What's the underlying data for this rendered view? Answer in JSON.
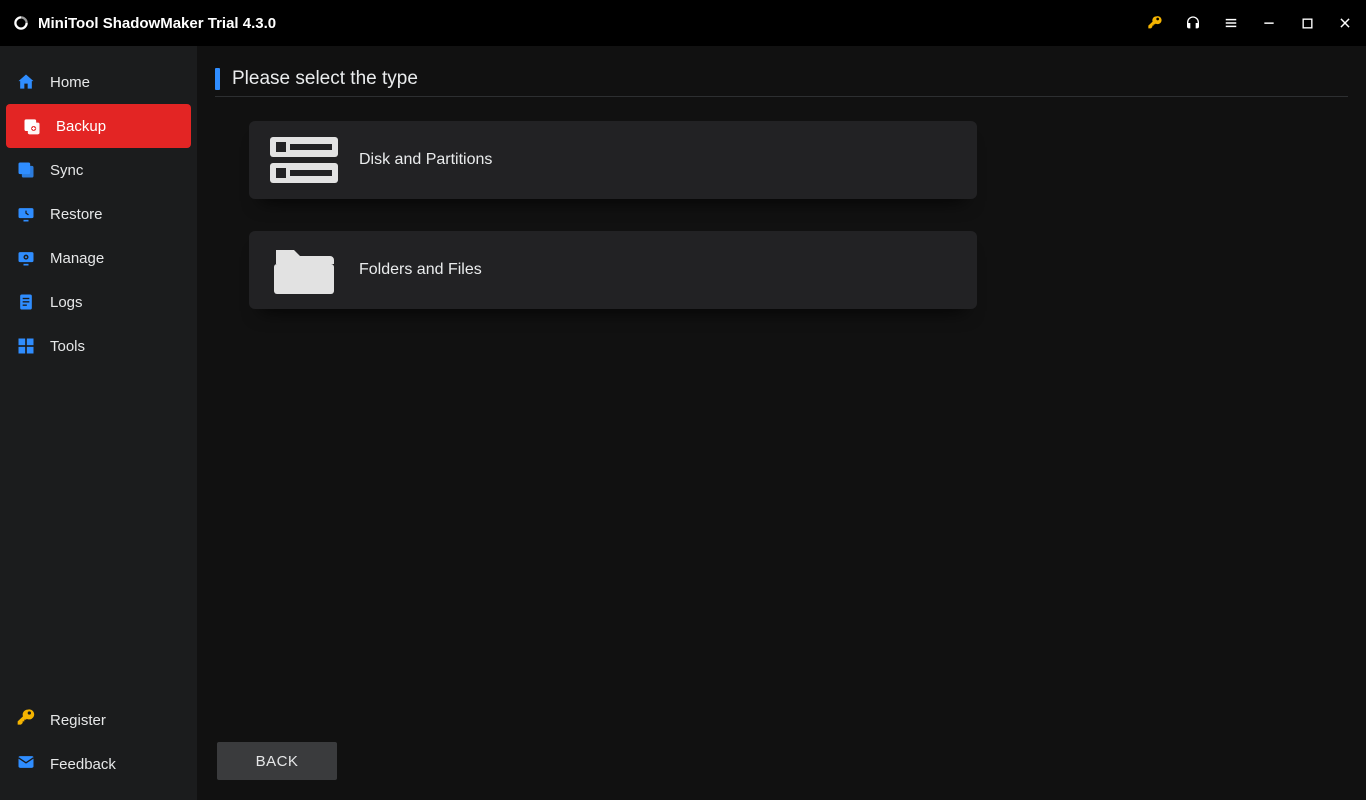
{
  "titlebar": {
    "title": "MiniTool ShadowMaker Trial 4.3.0"
  },
  "sidebar": {
    "items": [
      {
        "label": "Home"
      },
      {
        "label": "Backup"
      },
      {
        "label": "Sync"
      },
      {
        "label": "Restore"
      },
      {
        "label": "Manage"
      },
      {
        "label": "Logs"
      },
      {
        "label": "Tools"
      }
    ],
    "bottom": {
      "register": "Register",
      "feedback": "Feedback"
    }
  },
  "main": {
    "heading": "Please select the type",
    "options": [
      {
        "label": "Disk and Partitions"
      },
      {
        "label": "Folders and Files"
      }
    ],
    "back": "BACK"
  }
}
